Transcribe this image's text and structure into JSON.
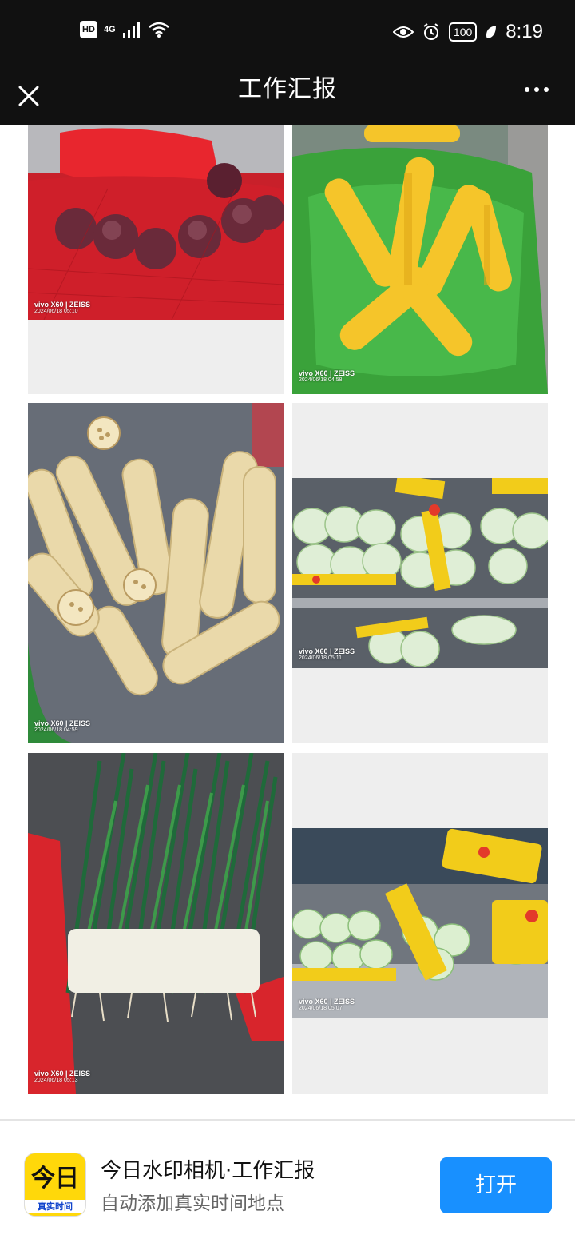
{
  "status_bar": {
    "hd": "HD",
    "network": "4G",
    "battery": "100",
    "time": "8:19"
  },
  "header": {
    "title": "工作汇报"
  },
  "photos": [
    {
      "model": "vivo X60 | ZEISS",
      "date": "2024/06/18 05:10"
    },
    {
      "model": "vivo X60 | ZEISS",
      "date": "2024/06/18 04:58"
    },
    {
      "model": "vivo X60 | ZEISS",
      "date": "2024/06/18 04:59"
    },
    {
      "model": "vivo X60 | ZEISS",
      "date": "2024/06/18 05:11"
    },
    {
      "model": "vivo X60 | ZEISS",
      "date": "2024/06/18 05:13"
    },
    {
      "model": "vivo X60 | ZEISS",
      "date": "2024/06/18 05:07"
    }
  ],
  "banner": {
    "icon_glyph": "今日",
    "icon_tag": "真实时间",
    "app_name": "今日水印相机·工作汇报",
    "subtitle": "自动添加真实时间地点",
    "open_label": "打开"
  },
  "colors": {
    "header_bg": "#111111",
    "open_button": "#1890ff",
    "app_icon_bg": "#ffd80a"
  }
}
